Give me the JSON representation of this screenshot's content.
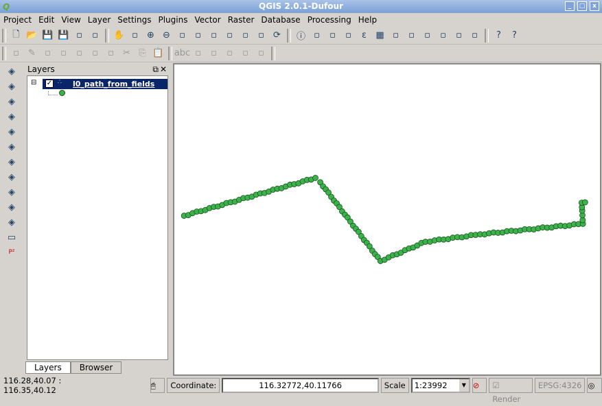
{
  "window": {
    "title": "QGIS 2.0.1-Dufour"
  },
  "menu": [
    "Project",
    "Edit",
    "View",
    "Layer",
    "Settings",
    "Plugins",
    "Vector",
    "Raster",
    "Database",
    "Processing",
    "Help"
  ],
  "toolbar1": [
    "new-project",
    "open-project",
    "save-project",
    "save-as",
    "new-print-composer",
    "composer-manager",
    "|",
    "pan",
    "pan-to-selection",
    "zoom-in",
    "zoom-out",
    "zoom-actual",
    "zoom-full",
    "zoom-to-selection",
    "zoom-to-layer",
    "zoom-last",
    "zoom-next",
    "refresh",
    "|",
    "identify",
    "action",
    "select",
    "deselect",
    "expression-select",
    "attribute-table",
    "statistics",
    "measure",
    "annotation",
    "text-annotation",
    "form-annotation",
    "text-tool",
    "|",
    "help",
    "whats-this"
  ],
  "toolbar2": [
    "current-edits",
    "toggle-editing",
    "save-edits",
    "add-feature",
    "move-feature",
    "node-tool",
    "delete-selected",
    "cut",
    "copy",
    "paste",
    "|",
    "label",
    "pin-labels",
    "show-hide-labels",
    "move-label",
    "rotate-label",
    "change-label",
    "|"
  ],
  "left_toolbar": [
    "add-vector-layer",
    "add-raster-layer",
    "add-postgis-layer",
    "add-spatialite-layer",
    "add-mssql-layer",
    "add-oracle-layer",
    "add-wms-layer",
    "add-wcs-layer",
    "add-wfs-layer",
    "add-delimited-text-layer",
    "new-shapefile-layer",
    "remove-layer",
    "plugin-p2"
  ],
  "layers_panel": {
    "title": "Layers",
    "layer_name": "l0_path_from_fields",
    "checked": true,
    "symbol_color": "#3cb34a",
    "tabs": [
      "Layers",
      "Browser"
    ]
  },
  "map": {
    "extent": [
      116.28,
      40.07,
      116.35,
      40.12
    ],
    "point_fill": "#3cb34a",
    "point_stroke": "#1a5020",
    "path_vertices": [
      [
        116.2816,
        40.0956
      ],
      [
        116.3032,
        40.1017
      ],
      [
        116.304,
        40.101
      ],
      [
        116.3139,
        40.0883
      ],
      [
        116.3213,
        40.0914
      ],
      [
        116.3303,
        40.0926
      ],
      [
        116.3472,
        40.0943
      ],
      [
        116.347,
        40.0977
      ],
      [
        116.3481,
        40.098
      ]
    ]
  },
  "status": {
    "extent": "116.28,40.07 : 116.35,40.12",
    "coordinate_label": "Coordinate:",
    "coordinate": "116.32772,40.11766",
    "scale_label": "Scale",
    "scale": "1:23992",
    "render_label": "Render",
    "render_checked": true,
    "crs": "EPSG:4326"
  }
}
